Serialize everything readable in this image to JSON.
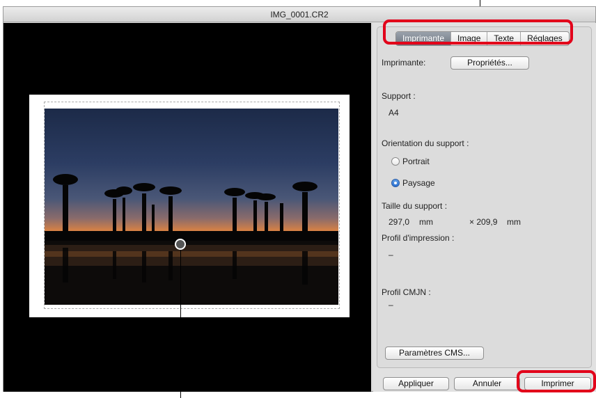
{
  "window": {
    "title": "IMG_0001.CR2"
  },
  "tabs": [
    {
      "label": "Imprimante",
      "active": true
    },
    {
      "label": "Image",
      "active": false
    },
    {
      "label": "Texte",
      "active": false
    },
    {
      "label": "Réglages",
      "active": false
    }
  ],
  "printer": {
    "label": "Imprimante:",
    "properties_button": "Propriétés..."
  },
  "support": {
    "label": "Support :",
    "value": "A4"
  },
  "orientation": {
    "label": "Orientation du support :",
    "options": [
      {
        "label": "Portrait",
        "selected": false
      },
      {
        "label": "Paysage",
        "selected": true
      }
    ]
  },
  "size": {
    "label": "Taille du support :",
    "width": "297,0",
    "width_unit": "mm",
    "height": "× 209,9",
    "height_unit": "mm"
  },
  "print_profile": {
    "label": "Profil d'impression :",
    "value": "–"
  },
  "cmyk_profile": {
    "label": "Profil CMJN :",
    "value": "–"
  },
  "buttons": {
    "cms": "Paramètres CMS...",
    "apply": "Appliquer",
    "cancel": "Annuler",
    "print": "Imprimer"
  },
  "colors": {
    "highlight": "#e2001a",
    "active_tab": "#7d858f",
    "radio_selected": "#2a6fd0"
  }
}
